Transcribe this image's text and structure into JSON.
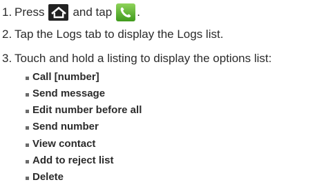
{
  "steps": [
    {
      "number": "1.",
      "text_before": "Press",
      "text_middle": "and tap",
      "text_after": ".",
      "icons": [
        "home-icon",
        "phone-icon"
      ]
    },
    {
      "number": "2.",
      "text": "Tap the Logs tab to display the Logs list."
    },
    {
      "number": "3.",
      "text": "Touch and hold a listing to display the options list:"
    }
  ],
  "options": [
    "Call [number]",
    "Send message",
    "Edit number before all",
    "Send number",
    "View contact",
    "Add to reject list",
    "Delete"
  ],
  "colors": {
    "text": "#2b2b2b",
    "home_icon_bg": "#222222",
    "phone_icon_bg": "#5fb52f",
    "bullet": "#6b6b6b"
  }
}
